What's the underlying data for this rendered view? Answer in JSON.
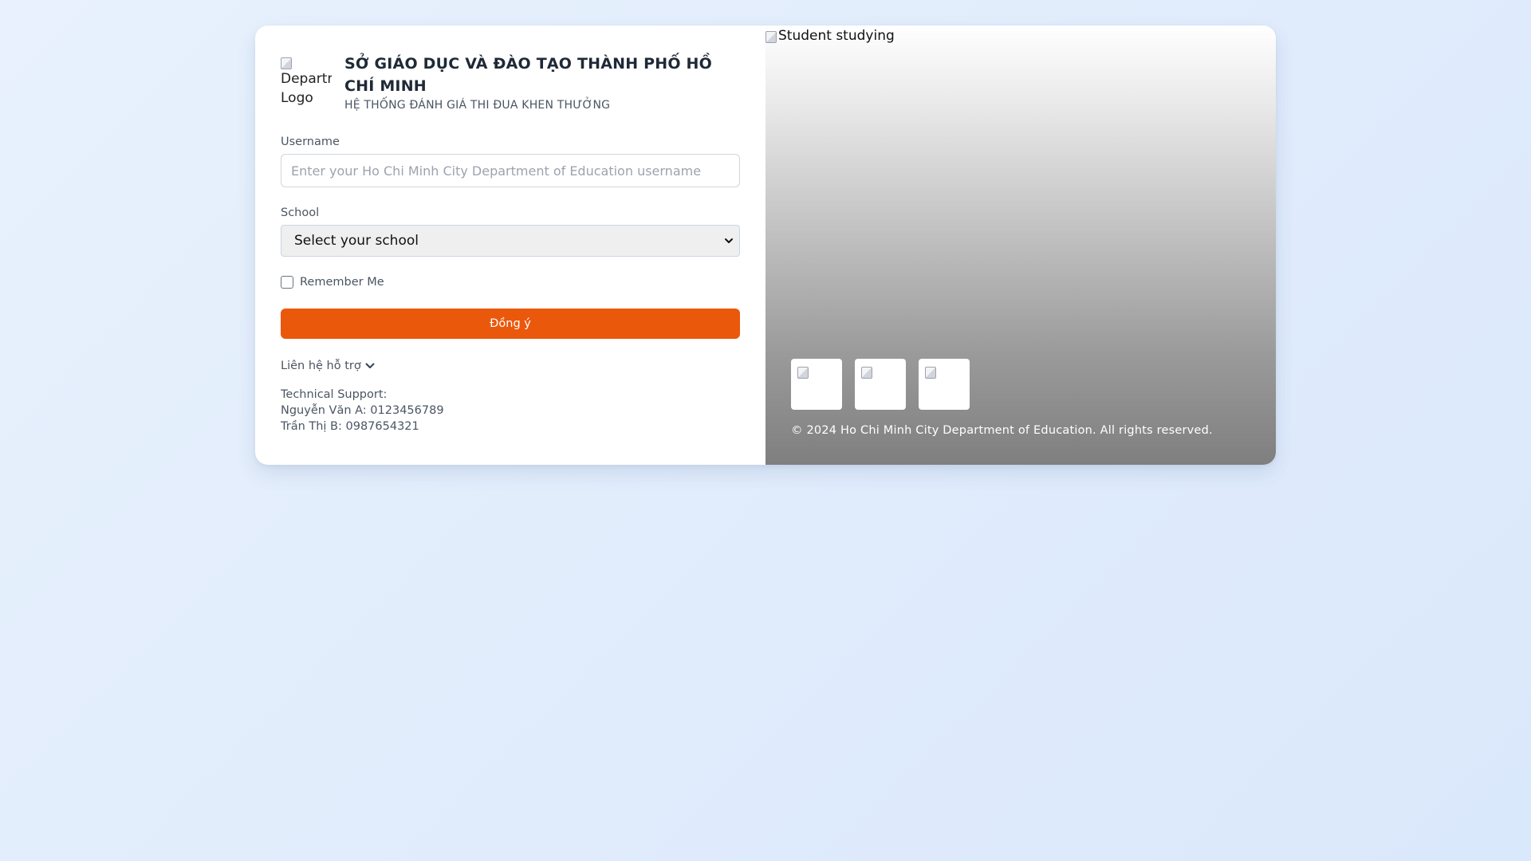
{
  "header": {
    "logo_alt": "Department Logo",
    "logo_alt_line1": "Departn",
    "logo_alt_line2": "Logo",
    "org_title": "SỞ GIÁO DỤC VÀ ĐÀO TẠO THÀNH PHỐ HỒ CHÍ MINH",
    "system_subtitle": "HỆ THỐNG ĐÁNH GIÁ THI ĐUA KHEN THƯỞNG"
  },
  "form": {
    "username_label": "Username",
    "username_value": "",
    "username_placeholder": "Enter your Ho Chi Minh City Department of Education username",
    "school_label": "School",
    "school_selected": "Select your school",
    "remember_label": "Remember Me",
    "remember_checked": false,
    "submit_label": "Đồng ý"
  },
  "support": {
    "toggle_label": "Liên hệ hỗ trợ",
    "heading": "Technical Support:",
    "contacts": [
      "Nguyễn Văn A: 0123456789",
      "Trần Thị B: 0987654321"
    ]
  },
  "hero": {
    "image_alt": "Student studying",
    "thumbnails": [
      "thumbnail-1",
      "thumbnail-2",
      "thumbnail-3"
    ],
    "copyright": "© 2024 Ho Chi Minh City Department of Education. All rights reserved."
  },
  "colors": {
    "accent": "#ea580c",
    "background": "#e3eefc",
    "card": "#ffffff"
  },
  "icons": {
    "support_toggle": "chevron-down-icon",
    "select": "chevron-down-icon",
    "broken_image": "broken-image-icon"
  }
}
